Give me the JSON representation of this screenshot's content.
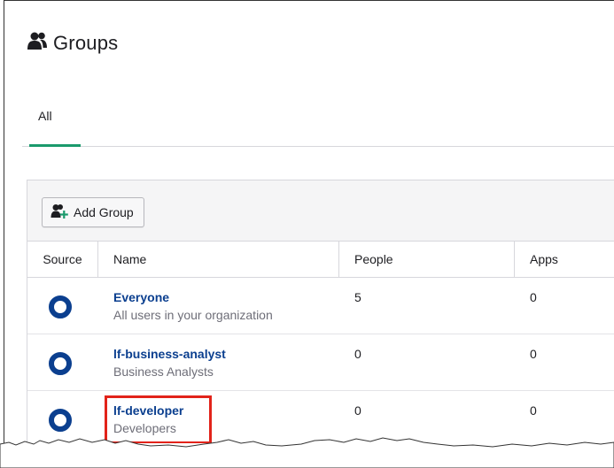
{
  "page": {
    "title": "Groups",
    "title_icon": "groups-icon"
  },
  "tabs": [
    {
      "label": "All",
      "active": true
    }
  ],
  "toolbar": {
    "add_group_label": "Add Group",
    "add_group_icon": "add-group-icon"
  },
  "table": {
    "columns": {
      "source": "Source",
      "name": "Name",
      "people": "People",
      "apps": "Apps"
    },
    "rows": [
      {
        "name": "Everyone",
        "description": "All users in your organization",
        "people": "5",
        "apps": "0",
        "source_icon": "okta-ring-icon"
      },
      {
        "name": "lf-business-analyst",
        "description": "Business Analysts",
        "people": "0",
        "apps": "0",
        "source_icon": "okta-ring-icon"
      },
      {
        "name": "lf-developer",
        "description": "Developers",
        "people": "0",
        "apps": "0",
        "source_icon": "okta-ring-icon",
        "highlighted": true
      }
    ]
  },
  "colors": {
    "link": "#0b3f8f",
    "active_tab": "#1a9a6c",
    "highlight": "#e2231a",
    "source_icon": "#0b3f8f"
  }
}
